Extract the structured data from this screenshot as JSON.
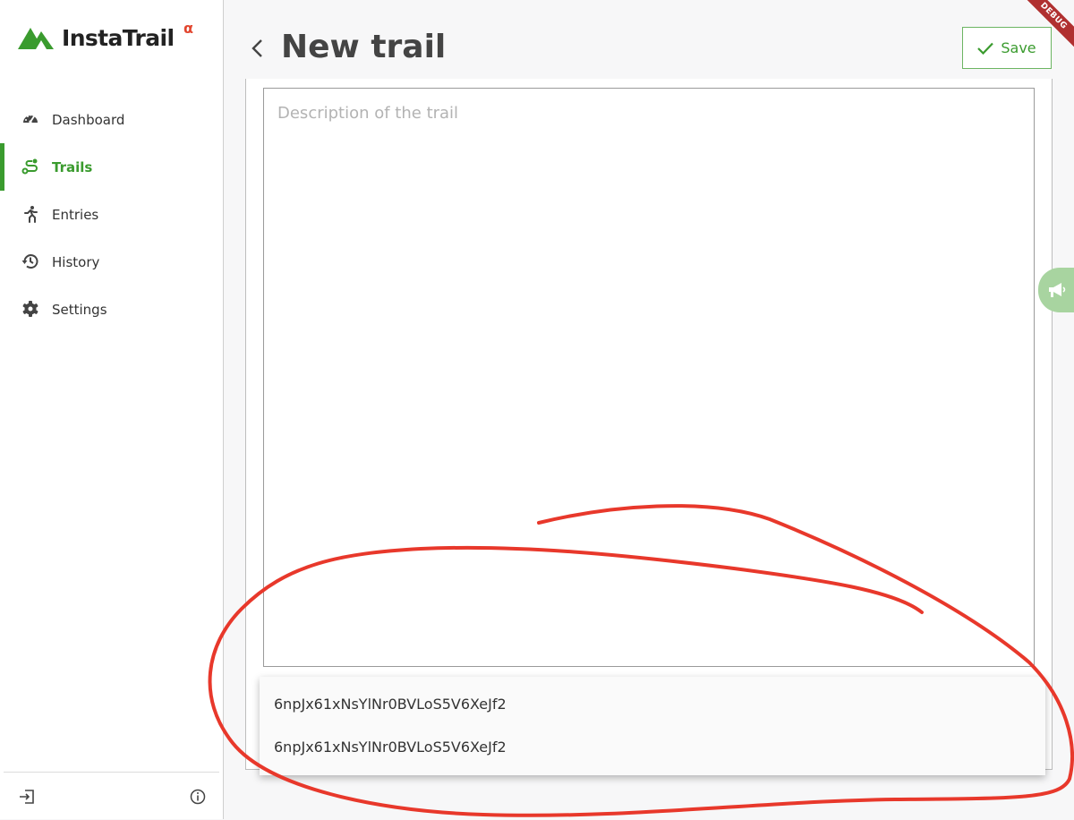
{
  "app": {
    "name": "InstaTrail",
    "badge": "α"
  },
  "sidebar": {
    "items": [
      {
        "label": "Dashboard",
        "icon": "speedometer-icon",
        "active": false
      },
      {
        "label": "Trails",
        "icon": "route-icon",
        "active": true
      },
      {
        "label": "Entries",
        "icon": "runner-icon",
        "active": false
      },
      {
        "label": "History",
        "icon": "history-icon",
        "active": false
      },
      {
        "label": "Settings",
        "icon": "gear-icon",
        "active": false
      }
    ],
    "footer": {
      "logout_icon": "logout-icon",
      "info_icon": "info-icon"
    }
  },
  "header": {
    "title": "New trail",
    "back_icon": "chevron-left-icon",
    "save_label": "Save"
  },
  "debug_banner": "DEBUG",
  "form": {
    "description": {
      "value": "",
      "placeholder": "Description of the trail"
    }
  },
  "autocomplete": {
    "options": [
      "6npJx61xNsYlNr0BVLoS5V6XeJf2",
      "6npJx61xNsYlNr0BVLoS5V6XeJf2"
    ]
  },
  "feedback_icon": "megaphone-icon",
  "colors": {
    "accent": "#3a9b2e",
    "annotation": "#e8382b",
    "debug": "#b03030"
  }
}
